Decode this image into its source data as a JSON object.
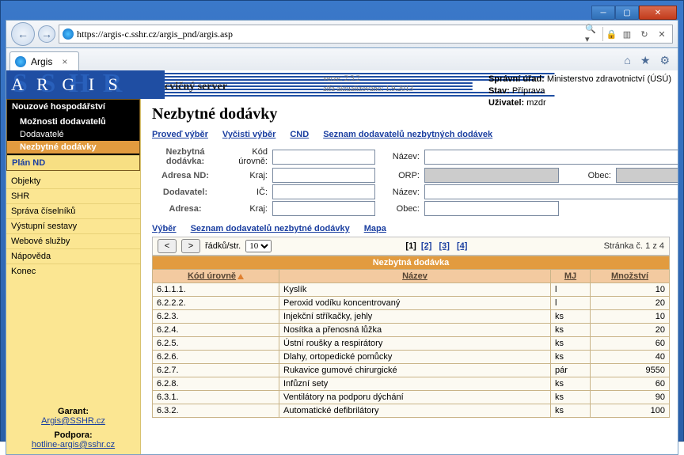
{
  "window": {
    "address": "https://argis-c.sshr.cz/argis_pnd/argis.asp",
    "tab_title": "Argis"
  },
  "header": {
    "logo_front": "A R G I S",
    "logo_back": "S S H R",
    "cvicny": "cvičný server",
    "ver1": "verze: 2.3.2",
    "ver2": "alfa aktualizováno: 1.9.2013",
    "spravni_lbl": "Správní úřad:",
    "spravni_val": "Ministerstvo zdravotnictví (ÚSÚ)",
    "stav_lbl": "Stav:",
    "stav_val": "Příprava",
    "uzivatel_lbl": "Uživatel:",
    "uzivatel_val": "mzdr"
  },
  "sidebar": {
    "head": "Nouzové hospodářství",
    "sub": [
      "Možnosti dodavatelů",
      "Dodavatelé",
      "Nezbytné dodávky"
    ],
    "item1": "Plán ND",
    "items": [
      "Objekty",
      "SHR",
      "Správa číselníků",
      "Výstupní sestavy",
      "Webové služby",
      "Nápověda",
      "Konec"
    ],
    "support": {
      "g_lbl": "Garant:",
      "g_mail": "Argis@SSHR.cz",
      "p_lbl": "Podpora:",
      "p_mail": "hotline-argis@sshr.cz"
    }
  },
  "main": {
    "title": "Nezbytné dodávky",
    "links": [
      "Proveď výběr",
      "Vyčisti výběr",
      "CND",
      "Seznam dodavatelů nezbytných dodávek"
    ],
    "search": {
      "g1": "Nezbytná dodávka:",
      "g2": "Adresa ND:",
      "g3": "Dodavatel:",
      "g4": "Adresa:",
      "kod": "Kód úrovně:",
      "nazev": "Název:",
      "kraj": "Kraj:",
      "orp": "ORP:",
      "obec": "Obec:",
      "ic": "IČ:"
    },
    "links2": [
      "Výběr",
      "Seznam dodavatelů nezbytné dodávky",
      "Mapa"
    ],
    "pager": {
      "rows_lbl": "řádků/str.",
      "rows_val": "10",
      "pages": [
        "[1]",
        "[2]",
        "[3]",
        "[4]"
      ],
      "info": "Stránka č. 1 z 4"
    },
    "table": {
      "caption": "Nezbytná dodávka",
      "cols": [
        "Kód úrovně",
        "Název",
        "MJ",
        "Množství"
      ],
      "rows": [
        {
          "k": "6.1.1.1.",
          "n": "Kyslík",
          "m": "l",
          "q": "10"
        },
        {
          "k": "6.2.2.2.",
          "n": "Peroxid vodíku koncentrovaný",
          "m": "l",
          "q": "20"
        },
        {
          "k": "6.2.3.",
          "n": "Injekční stříkačky, jehly",
          "m": "ks",
          "q": "10"
        },
        {
          "k": "6.2.4.",
          "n": "Nosítka a přenosná lůžka",
          "m": "ks",
          "q": "20"
        },
        {
          "k": "6.2.5.",
          "n": "Ústní roušky a respirátory",
          "m": "ks",
          "q": "60"
        },
        {
          "k": "6.2.6.",
          "n": "Dlahy, ortopedické pomůcky",
          "m": "ks",
          "q": "40"
        },
        {
          "k": "6.2.7.",
          "n": "Rukavice gumové chirurgické",
          "m": "pár",
          "q": "9550"
        },
        {
          "k": "6.2.8.",
          "n": "Infůzní sety",
          "m": "ks",
          "q": "60"
        },
        {
          "k": "6.3.1.",
          "n": "Ventilátory na podporu dýchání",
          "m": "ks",
          "q": "90"
        },
        {
          "k": "6.3.2.",
          "n": "Automatické defibrilátory",
          "m": "ks",
          "q": "100"
        }
      ]
    }
  }
}
